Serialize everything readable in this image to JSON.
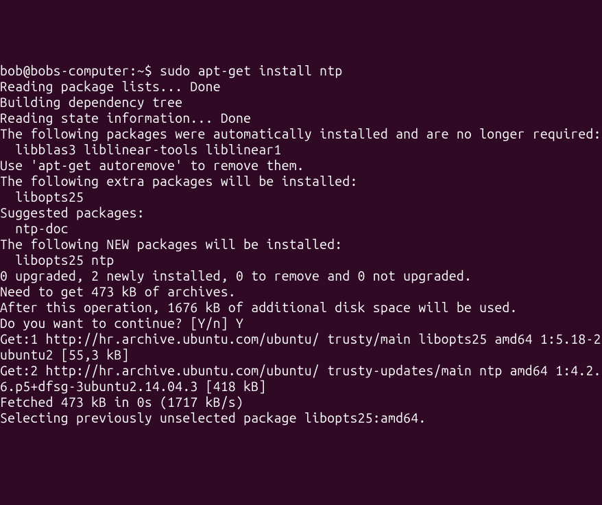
{
  "terminal": {
    "prompt": {
      "user_host": "bob@bobs-computer",
      "separator": ":",
      "path": "~",
      "end": "$ "
    },
    "command": "sudo apt-get install ntp",
    "lines": [
      "Reading package lists... Done",
      "Building dependency tree",
      "Reading state information... Done",
      "The following packages were automatically installed and are no longer required:",
      "  libblas3 liblinear-tools liblinear1",
      "Use 'apt-get autoremove' to remove them.",
      "The following extra packages will be installed:",
      "  libopts25",
      "Suggested packages:",
      "  ntp-doc",
      "The following NEW packages will be installed:",
      "  libopts25 ntp",
      "0 upgraded, 2 newly installed, 0 to remove and 0 not upgraded.",
      "Need to get 473 kB of archives.",
      "After this operation, 1676 kB of additional disk space will be used.",
      "Do you want to continue? [Y/n] Y",
      "Get:1 http://hr.archive.ubuntu.com/ubuntu/ trusty/main libopts25 amd64 1:5.18-2ubuntu2 [55,3 kB]",
      "Get:2 http://hr.archive.ubuntu.com/ubuntu/ trusty-updates/main ntp amd64 1:4.2.6.p5+dfsg-3ubuntu2.14.04.3 [418 kB]",
      "Fetched 473 kB in 0s (1717 kB/s)",
      "Selecting previously unselected package libopts25:amd64."
    ]
  }
}
